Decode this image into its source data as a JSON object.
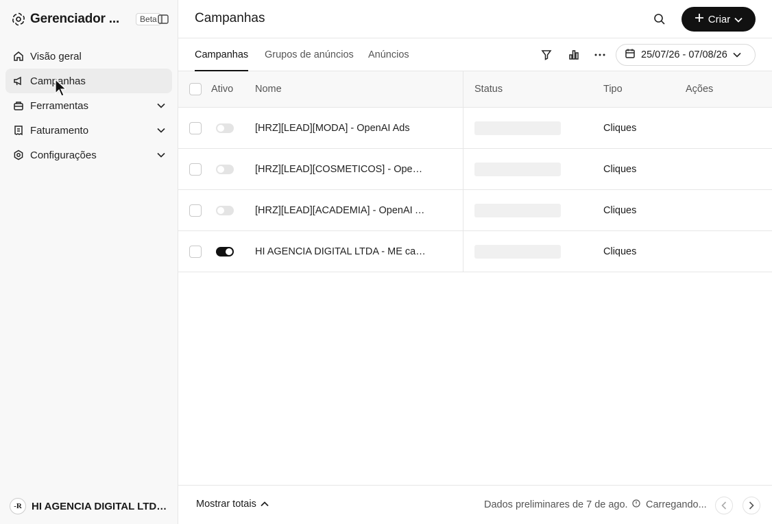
{
  "sidebar": {
    "brand": {
      "title": "Gerenciador ...",
      "badge": "Beta"
    },
    "items": [
      {
        "label": "Visão geral",
        "icon": "home-icon",
        "active": false,
        "expandable": false
      },
      {
        "label": "Campanhas",
        "icon": "megaphone-icon",
        "active": true,
        "expandable": false
      },
      {
        "label": "Ferramentas",
        "icon": "toolbox-icon",
        "active": false,
        "expandable": true
      },
      {
        "label": "Faturamento",
        "icon": "receipt-icon",
        "active": false,
        "expandable": true
      },
      {
        "label": "Configurações",
        "icon": "gear-icon",
        "active": false,
        "expandable": true
      }
    ],
    "account": {
      "name": "HI AGENCIA DIGITAL LTDA - ...",
      "avatar": "-R"
    }
  },
  "header": {
    "title": "Campanhas",
    "create_label": "Criar"
  },
  "tabs": [
    {
      "label": "Campanhas",
      "active": true
    },
    {
      "label": "Grupos de anúncios",
      "active": false
    },
    {
      "label": "Anúncios",
      "active": false
    }
  ],
  "date_range": "25/07/26 - 07/08/26",
  "table": {
    "columns": {
      "active": "Ativo",
      "name": "Nome",
      "status": "Status",
      "type": "Tipo",
      "actions": "Ações"
    },
    "rows": [
      {
        "active": false,
        "name": "[HRZ][LEAD][MODA] - OpenAI Ads",
        "type": "Cliques"
      },
      {
        "active": false,
        "name": "[HRZ][LEAD][COSMETICOS] - OpenA...",
        "type": "Cliques"
      },
      {
        "active": false,
        "name": "[HRZ][LEAD][ACADEMIA] - OpenAI Ads",
        "type": "Cliques"
      },
      {
        "active": true,
        "name": "HI AGENCIA DIGITAL LTDA - ME cam...",
        "type": "Cliques"
      }
    ]
  },
  "footer": {
    "show_totals": "Mostrar totais",
    "preliminary": "Dados preliminares de 7 de ago.",
    "loading": "Carregando..."
  },
  "colors": {
    "accent": "#111111",
    "sidebar_bg": "#f8f8f8",
    "border": "#e6e6e6"
  }
}
